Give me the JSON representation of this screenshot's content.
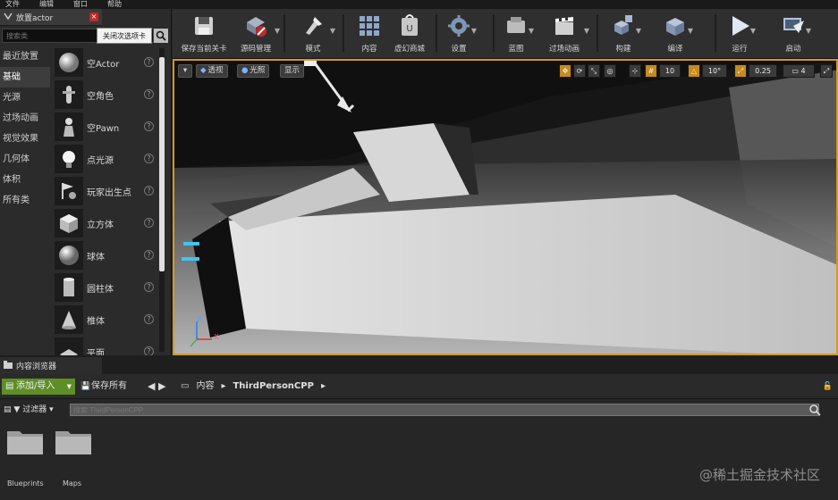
{
  "menu": [
    "文件",
    "编辑",
    "窗口",
    "帮助"
  ],
  "place_actor": {
    "tab_title": "放置actor",
    "close_tooltip": "关闭次选项卡",
    "search_placeholder": "搜索类",
    "categories": [
      "最近放置",
      "基础",
      "光源",
      "过场动画",
      "视觉效果",
      "几何体",
      "体积",
      "所有类"
    ],
    "active_category": "基础",
    "actors": [
      "空Actor",
      "空角色",
      "空Pawn",
      "点光源",
      "玩家出生点",
      "立方体",
      "球体",
      "圆柱体",
      "椎体",
      "平面"
    ]
  },
  "toolbar": {
    "items": [
      {
        "label": "保存当前关卡",
        "icon": "save-icon"
      },
      {
        "label": "源码管理",
        "icon": "source-control-icon"
      },
      {
        "label": "模式",
        "icon": "modes-icon"
      },
      {
        "label": "内容",
        "icon": "content-icon"
      },
      {
        "label": "虚幻商城",
        "icon": "marketplace-icon"
      },
      {
        "label": "设置",
        "icon": "settings-icon"
      },
      {
        "label": "蓝图",
        "icon": "blueprint-icon"
      },
      {
        "label": "过场动画",
        "icon": "cinematics-icon"
      },
      {
        "label": "构建",
        "icon": "build-icon"
      },
      {
        "label": "编译",
        "icon": "compile-icon"
      },
      {
        "label": "运行",
        "icon": "play-icon"
      },
      {
        "label": "启动",
        "icon": "launch-icon"
      }
    ]
  },
  "viewport": {
    "perspective": "透视",
    "lit": "光照",
    "show": "显示",
    "grid_snap": "10",
    "rotation_snap": "10°",
    "scale_snap": "0.25",
    "camera_speed": "4",
    "axis_z": "Z",
    "axis_x": "X"
  },
  "content_browser": {
    "tab_title": "内容浏览器",
    "add_import": "添加/导入",
    "save_all": "保存所有",
    "breadcrumb": [
      "内容",
      "ThirdPersonCPP"
    ],
    "filters": "过滤器",
    "search_placeholder": "搜索 ThirdPersonCPP",
    "folders": [
      "Blueprints",
      "Maps"
    ]
  },
  "watermark": "@稀土掘金技术社区"
}
